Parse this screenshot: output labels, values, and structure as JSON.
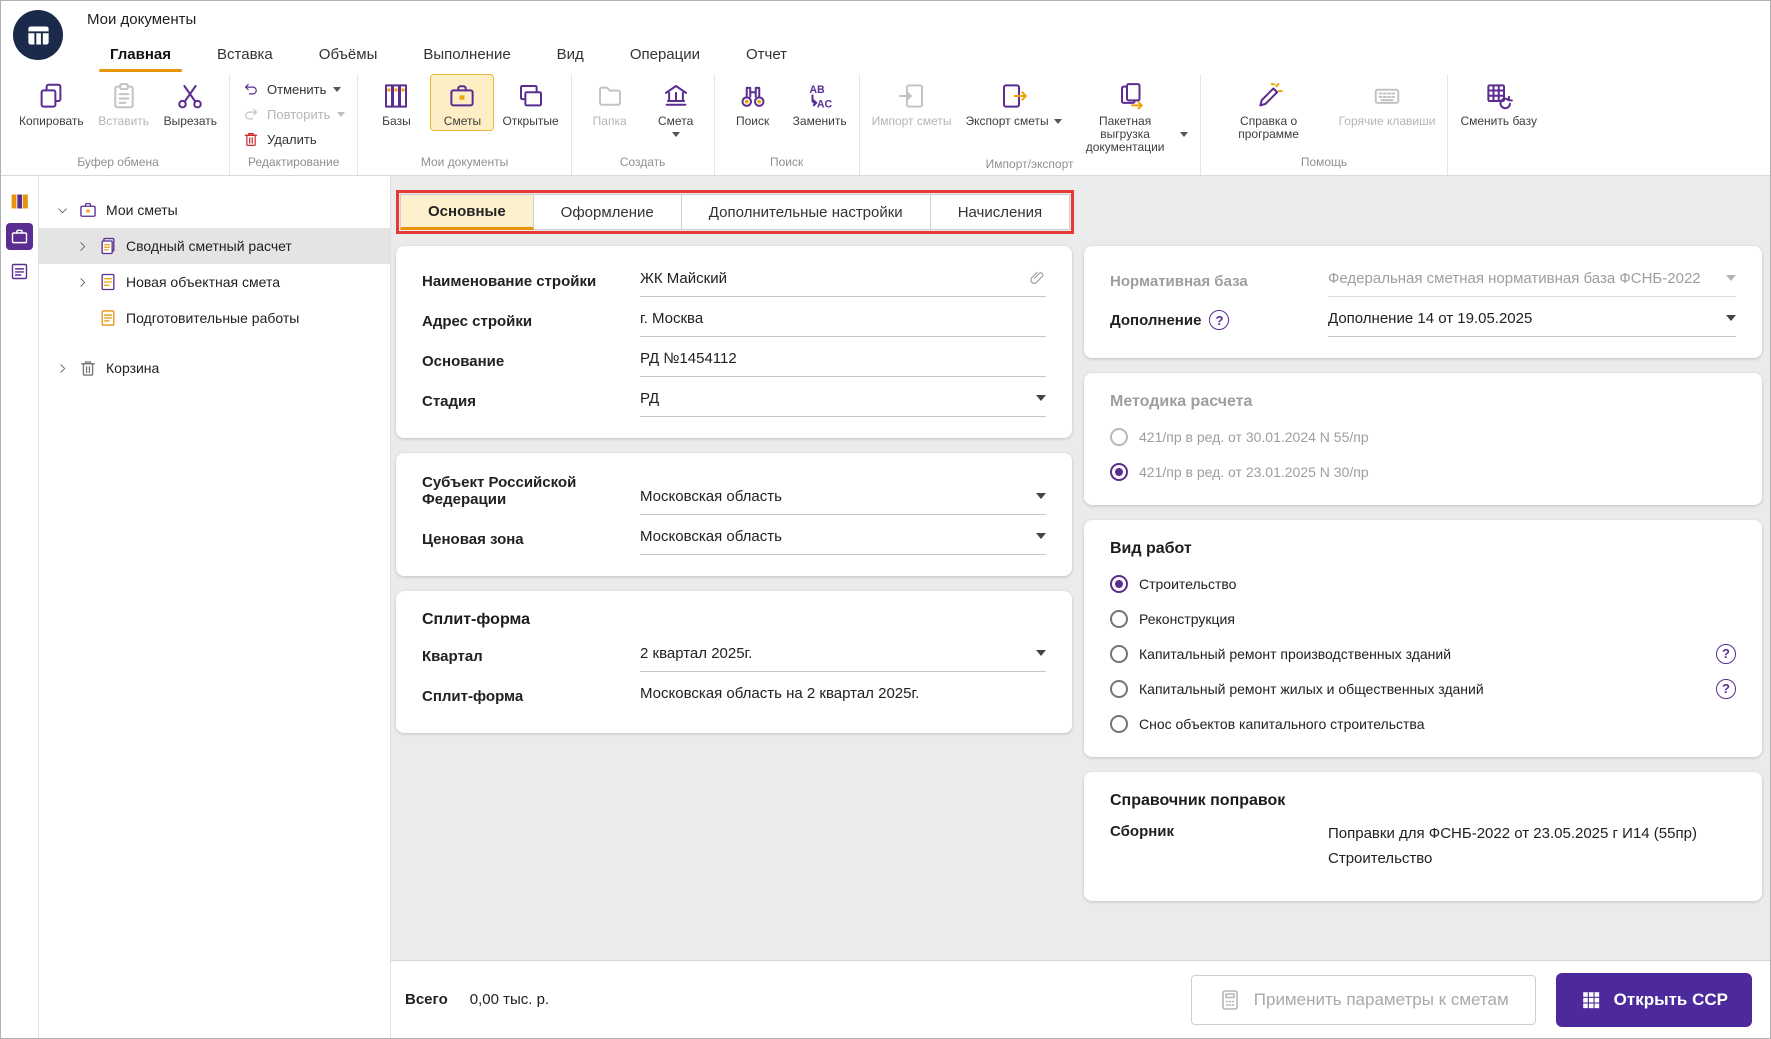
{
  "colors": {
    "accent_purple": "#5b2d90",
    "primary_button": "#4c2a9c",
    "accent_orange": "#f0a30a",
    "active_tab_underline": "#e8940a",
    "annotation_red": "#e53935"
  },
  "titlebar": {
    "title": "Мои документы"
  },
  "ribbonTabs": [
    {
      "label": "Главная",
      "active": true
    },
    {
      "label": "Вставка"
    },
    {
      "label": "Объёмы"
    },
    {
      "label": "Выполнение"
    },
    {
      "label": "Вид"
    },
    {
      "label": "Операции"
    },
    {
      "label": "Отчет"
    }
  ],
  "ribbon": {
    "groups": [
      {
        "label": "Буфер обмена",
        "buttons": [
          {
            "label": "Копировать",
            "icon": "copy-icon"
          },
          {
            "label": "Вставить",
            "icon": "paste-icon",
            "disabled": true
          },
          {
            "label": "Вырезать",
            "icon": "scissors-icon"
          }
        ]
      },
      {
        "label": "Редактирование",
        "buttons": [
          {
            "label": "Отменить",
            "icon": "undo-icon",
            "dropdown": true
          },
          {
            "label": "Повторить",
            "icon": "redo-icon",
            "dropdown": true,
            "disabled": true
          },
          {
            "label": "Удалить",
            "icon": "trash-icon"
          }
        ]
      },
      {
        "label": "Мои документы",
        "buttons": [
          {
            "label": "Базы",
            "icon": "databases-icon"
          },
          {
            "label": "Сметы",
            "icon": "briefcase-icon",
            "selected": true
          },
          {
            "label": "Открытые",
            "icon": "windows-icon"
          }
        ]
      },
      {
        "label": "Создать",
        "buttons": [
          {
            "label": "Папка",
            "icon": "folder-icon",
            "disabled": true
          },
          {
            "label": "Смета",
            "icon": "building-icon",
            "dropdown": true
          }
        ]
      },
      {
        "label": "Поиск",
        "buttons": [
          {
            "label": "Поиск",
            "icon": "binoculars-icon"
          },
          {
            "label": "Заменить",
            "icon": "replace-icon"
          }
        ]
      },
      {
        "label": "Импорт/экспорт",
        "buttons": [
          {
            "label": "Импорт сметы",
            "icon": "import-icon",
            "disabled": true
          },
          {
            "label": "Экспорт сметы",
            "icon": "export-icon",
            "dropdown": true
          },
          {
            "label": "Пакетная выгрузка документации",
            "icon": "batch-export-icon",
            "dropdown": true
          }
        ]
      },
      {
        "label": "Помощь",
        "buttons": [
          {
            "label": "Справка о программе",
            "icon": "pencil-icon"
          },
          {
            "label": "Горячие клавиши",
            "icon": "keyboard-icon",
            "disabled": true
          }
        ]
      },
      {
        "label": "",
        "buttons": [
          {
            "label": "Сменить базу",
            "icon": "change-base-icon"
          }
        ]
      }
    ]
  },
  "tree": {
    "items": [
      {
        "label": "Мои сметы",
        "expanded": true
      },
      {
        "label": "Сводный сметный расчет",
        "selected": true
      },
      {
        "label": "Новая объектная смета"
      },
      {
        "label": "Подготовительные работы"
      },
      {
        "label": "Корзина"
      }
    ]
  },
  "tabs": [
    {
      "label": "Основные",
      "active": true
    },
    {
      "label": "Оформление"
    },
    {
      "label": "Дополнительные настройки"
    },
    {
      "label": "Начисления"
    }
  ],
  "form": {
    "stroika": {
      "name_label": "Наименование стройки",
      "name_value": "ЖК Майский",
      "address_label": "Адрес стройки",
      "address_value": "г. Москва",
      "basis_label": "Основание",
      "basis_value": "РД №1454112",
      "stage_label": "Стадия",
      "stage_value": "РД"
    },
    "region": {
      "subject_label": "Субъект Российской Федерации",
      "subject_value": "Московская область",
      "zone_label": "Ценовая зона",
      "zone_value": "Московская область"
    },
    "split": {
      "heading": "Сплит-форма",
      "quarter_label": "Квартал",
      "quarter_value": "2 квартал 2025г.",
      "split_label": "Сплит-форма",
      "split_value": "Московская область на 2 квартал 2025г."
    },
    "normbase": {
      "base_label": "Нормативная база",
      "base_value": "Федеральная сметная нормативная база ФСНБ-2022",
      "addition_label": "Дополнение",
      "addition_value": "Дополнение 14 от 19.05.2025",
      "help_glyph": "?"
    },
    "method": {
      "heading": "Методика расчета",
      "options": [
        {
          "label": "421/пр в ред. от 30.01.2024 N 55/пр",
          "checked": false
        },
        {
          "label": "421/пр в ред. от 23.01.2025 N 30/пр",
          "checked": true
        }
      ]
    },
    "worktype": {
      "heading": "Вид работ",
      "options": [
        {
          "label": "Строительство",
          "checked": true
        },
        {
          "label": "Реконструкция",
          "checked": false
        },
        {
          "label": "Капитальный ремонт производственных зданий",
          "checked": false,
          "help": true
        },
        {
          "label": "Капитальный ремонт жилых и общественных зданий",
          "checked": false,
          "help": true
        },
        {
          "label": "Снос объектов капитального строительства",
          "checked": false
        }
      ],
      "help_glyph": "?"
    },
    "corrections": {
      "heading": "Справочник поправок",
      "sbornik_label": "Сборник",
      "sbornik_value_line1": "Поправки для ФСНБ-2022 от 23.05.2025 г И14 (55пр)",
      "sbornik_value_line2": "Строительство"
    }
  },
  "footer": {
    "total_label": "Всего",
    "total_value": "0,00 тыс. р.",
    "apply_button": "Применить параметры к сметам",
    "open_button": "Открыть ССР"
  }
}
